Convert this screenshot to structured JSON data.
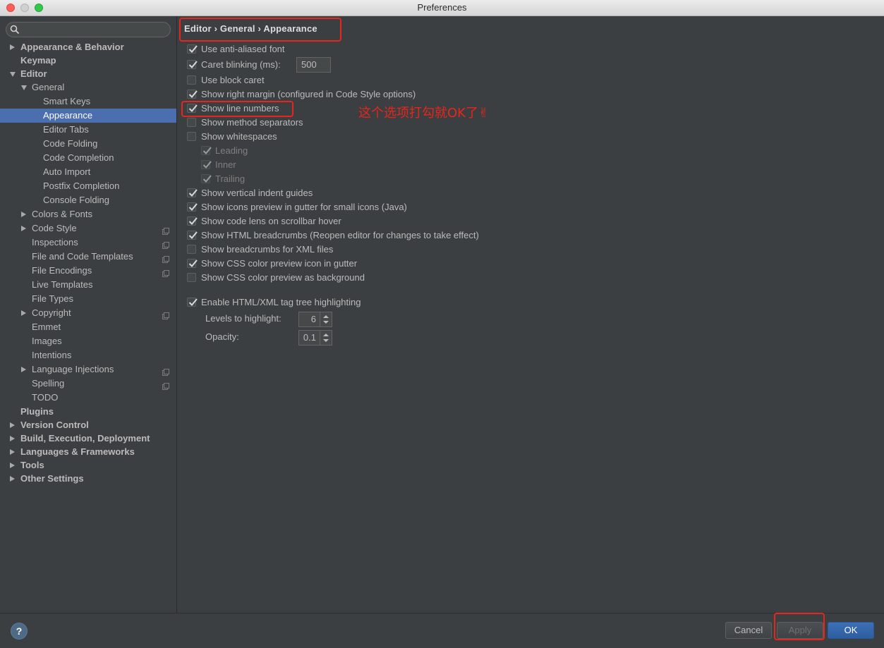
{
  "window": {
    "title": "Preferences"
  },
  "search": {
    "placeholder": "",
    "value": ""
  },
  "tree": [
    {
      "label": "Appearance & Behavior",
      "level": 0,
      "bold": true,
      "arrow": "right"
    },
    {
      "label": "Keymap",
      "level": 0,
      "bold": true,
      "arrow": "none"
    },
    {
      "label": "Editor",
      "level": 0,
      "bold": true,
      "arrow": "down"
    },
    {
      "label": "General",
      "level": 1,
      "arrow": "down"
    },
    {
      "label": "Smart Keys",
      "level": 2,
      "arrow": "none"
    },
    {
      "label": "Appearance",
      "level": 2,
      "arrow": "none",
      "selected": true
    },
    {
      "label": "Editor Tabs",
      "level": 2,
      "arrow": "none"
    },
    {
      "label": "Code Folding",
      "level": 2,
      "arrow": "none"
    },
    {
      "label": "Code Completion",
      "level": 2,
      "arrow": "none"
    },
    {
      "label": "Auto Import",
      "level": 2,
      "arrow": "none"
    },
    {
      "label": "Postfix Completion",
      "level": 2,
      "arrow": "none"
    },
    {
      "label": "Console Folding",
      "level": 2,
      "arrow": "none"
    },
    {
      "label": "Colors & Fonts",
      "level": 1,
      "arrow": "right"
    },
    {
      "label": "Code Style",
      "level": 1,
      "arrow": "right",
      "projectIcon": true
    },
    {
      "label": "Inspections",
      "level": 1,
      "arrow": "none",
      "projectIcon": true
    },
    {
      "label": "File and Code Templates",
      "level": 1,
      "arrow": "none",
      "projectIcon": true
    },
    {
      "label": "File Encodings",
      "level": 1,
      "arrow": "none",
      "projectIcon": true
    },
    {
      "label": "Live Templates",
      "level": 1,
      "arrow": "none"
    },
    {
      "label": "File Types",
      "level": 1,
      "arrow": "none"
    },
    {
      "label": "Copyright",
      "level": 1,
      "arrow": "right",
      "projectIcon": true
    },
    {
      "label": "Emmet",
      "level": 1,
      "arrow": "none"
    },
    {
      "label": "Images",
      "level": 1,
      "arrow": "none"
    },
    {
      "label": "Intentions",
      "level": 1,
      "arrow": "none"
    },
    {
      "label": "Language Injections",
      "level": 1,
      "arrow": "right",
      "projectIcon": true
    },
    {
      "label": "Spelling",
      "level": 1,
      "arrow": "none",
      "projectIcon": true
    },
    {
      "label": "TODO",
      "level": 1,
      "arrow": "none"
    },
    {
      "label": "Plugins",
      "level": 0,
      "bold": true,
      "arrow": "none"
    },
    {
      "label": "Version Control",
      "level": 0,
      "bold": true,
      "arrow": "right"
    },
    {
      "label": "Build, Execution, Deployment",
      "level": 0,
      "bold": true,
      "arrow": "right"
    },
    {
      "label": "Languages & Frameworks",
      "level": 0,
      "bold": true,
      "arrow": "right"
    },
    {
      "label": "Tools",
      "level": 0,
      "bold": true,
      "arrow": "right"
    },
    {
      "label": "Other Settings",
      "level": 0,
      "bold": true,
      "arrow": "right"
    }
  ],
  "breadcrumb": "Editor › General › Appearance",
  "options": [
    {
      "label": "Use anti-aliased font",
      "checked": true
    },
    {
      "label": "Caret blinking (ms):",
      "checked": true
    },
    {
      "label": "Use block caret",
      "checked": false
    },
    {
      "label": "Show right margin (configured in Code Style options)",
      "checked": true
    },
    {
      "label": "Show line numbers",
      "checked": true
    },
    {
      "label": "Show method separators",
      "checked": false
    },
    {
      "label": "Show whitespaces",
      "checked": false
    },
    {
      "label": "Leading",
      "checked": true,
      "disabled": true
    },
    {
      "label": "Inner",
      "checked": true,
      "disabled": true
    },
    {
      "label": "Trailing",
      "checked": true,
      "disabled": true
    },
    {
      "label": "Show vertical indent guides",
      "checked": true
    },
    {
      "label": "Show icons preview in gutter for small icons (Java)",
      "checked": true
    },
    {
      "label": "Show code lens on scrollbar hover",
      "checked": true
    },
    {
      "label": "Show HTML breadcrumbs (Reopen editor for changes to take effect)",
      "checked": true
    },
    {
      "label": "Show breadcrumbs for XML files",
      "checked": false
    },
    {
      "label": "Show CSS color preview icon in gutter",
      "checked": true
    },
    {
      "label": "Show CSS color preview as background",
      "checked": false
    },
    {
      "label": "Enable HTML/XML tag tree highlighting",
      "checked": true
    }
  ],
  "caret_blinking_value": "500",
  "levels": {
    "label": "Levels to highlight:",
    "value": "6"
  },
  "opacity": {
    "label": "Opacity:",
    "value": "0.1"
  },
  "annotation": "这个选项打勾就OK了✌",
  "buttons": {
    "help": "?",
    "cancel": "Cancel",
    "apply": "Apply",
    "ok": "OK"
  },
  "colors": {
    "highlight": "#e8251c",
    "selection": "#4b6eaf",
    "background": "#3c3f41"
  }
}
